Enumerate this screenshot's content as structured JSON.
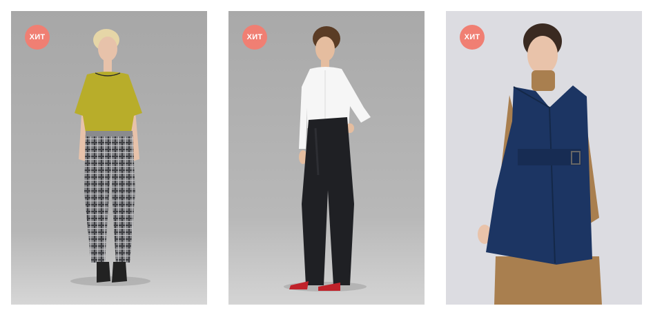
{
  "products": [
    {
      "badge": "ХИТ",
      "colors": {
        "background": "#b2b2b2",
        "top": "#b8ad2a",
        "bottom": "#7e7f82",
        "shoes": "#222222",
        "skin": "#e7c2aa",
        "hair": "#e6d6a7"
      }
    },
    {
      "badge": "ХИТ",
      "colors": {
        "background": "#b3b3b3",
        "top": "#f6f6f6",
        "bottom": "#1f2024",
        "shoes": "#c0222a",
        "skin": "#e5bd9f",
        "hair": "#5a3c25"
      }
    },
    {
      "badge": "ХИТ",
      "colors": {
        "background": "#dcdce1",
        "top": "#a97f4f",
        "bottom": "#a97f4f",
        "vest": "#1c3563",
        "skin": "#e9c3aa",
        "hair": "#3a2a21"
      }
    }
  ],
  "theme": {
    "badge_color": "#f07f73",
    "page_background": "#ffffff"
  }
}
